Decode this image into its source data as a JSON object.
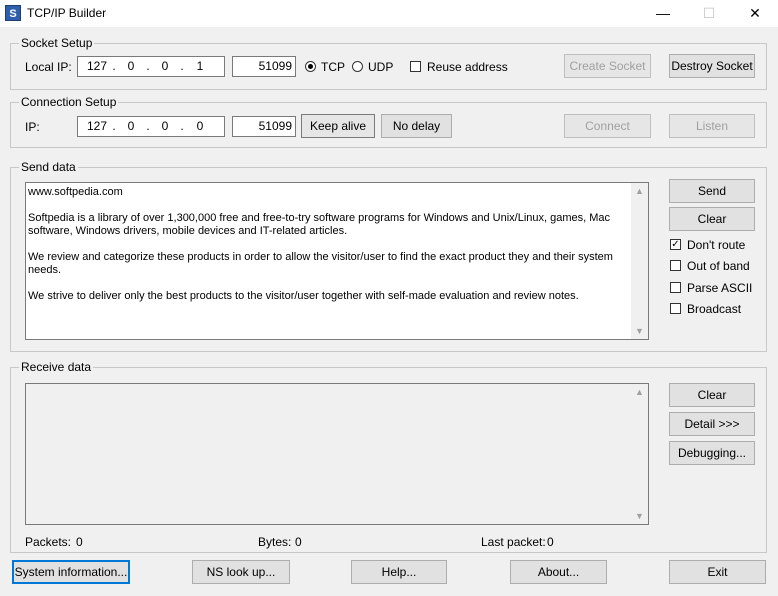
{
  "window": {
    "title": "TCP/IP Builder",
    "icon_letter": "S",
    "minimize_glyph": "—",
    "maximize_glyph": "☐",
    "close_glyph": "✕"
  },
  "socket_setup": {
    "label": "Socket Setup",
    "local_ip_label": "Local IP:",
    "ip": [
      "127",
      "0",
      "0",
      "1"
    ],
    "port": "51099",
    "tcp_label": "TCP",
    "udp_label": "UDP",
    "protocol": "TCP",
    "reuse_label": "Reuse address",
    "reuse_checked": false,
    "create_socket": "Create Socket",
    "destroy_socket": "Destroy Socket"
  },
  "connection_setup": {
    "label": "Connection Setup",
    "ip_label": "IP:",
    "ip": [
      "127",
      "0",
      "0",
      "0"
    ],
    "port": "51099",
    "keep_alive": "Keep alive",
    "no_delay": "No delay",
    "connect": "Connect",
    "listen": "Listen"
  },
  "send_data": {
    "label": "Send data",
    "text": "www.softpedia.com\n\nSoftpedia is a library of over 1,300,000 free and free-to-try software programs for Windows and Unix/Linux, games, Mac\nsoftware, Windows drivers, mobile devices and IT-related articles.\n\nWe review and categorize these products in order to allow the visitor/user to find the exact product they and their system needs.\n\nWe strive to deliver only the best products to the visitor/user together with self-made evaluation and review notes.",
    "send": "Send",
    "clear": "Clear",
    "options": [
      {
        "label": "Don't route",
        "checked": true
      },
      {
        "label": "Out of band",
        "checked": false
      },
      {
        "label": "Parse ASCII",
        "checked": false
      },
      {
        "label": "Broadcast",
        "checked": false
      }
    ]
  },
  "receive_data": {
    "label": "Receive data",
    "clear": "Clear",
    "detail": "Detail >>>",
    "debugging": "Debugging...",
    "packets_label": "Packets:",
    "packets": "0",
    "bytes_label": "Bytes:",
    "bytes": "0",
    "last_packet_label": "Last packet:",
    "last_packet": "0"
  },
  "footer": {
    "system_information": "System information...",
    "ns_lookup": "NS look up...",
    "help": "Help...",
    "about": "About...",
    "exit": "Exit"
  },
  "icons": {
    "check": "✓",
    "scroll_up": "▲",
    "scroll_down": "▼"
  }
}
